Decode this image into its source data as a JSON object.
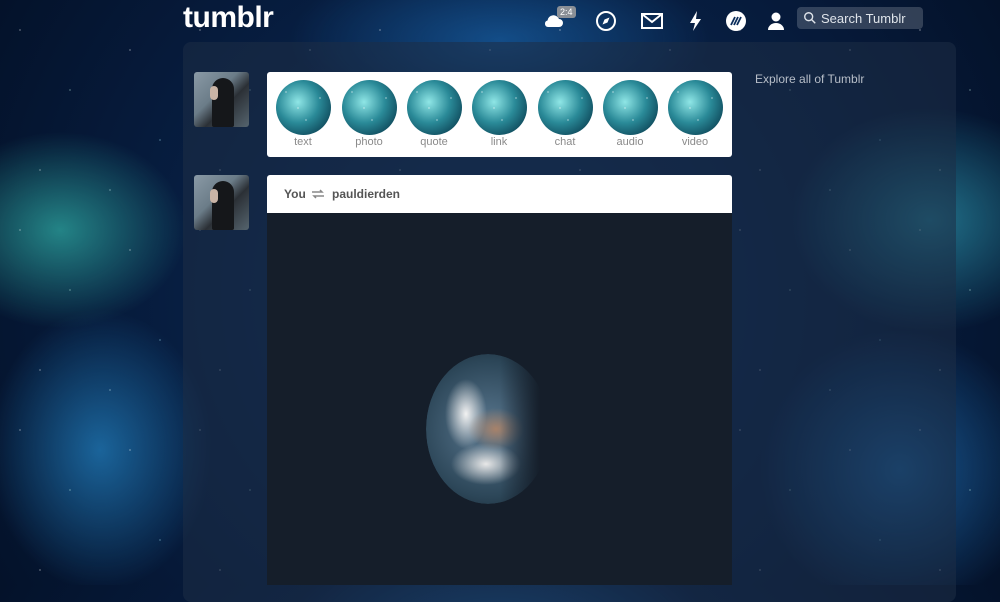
{
  "header": {
    "logo": "tumblr",
    "badge": "2:4",
    "search_placeholder": "Search Tumblr"
  },
  "nav_icons": [
    "dashboard-cloud-icon",
    "explore-compass-icon",
    "inbox-mail-icon",
    "activity-lightning-icon",
    "patio-icon",
    "account-person-icon"
  ],
  "sidebar": {
    "explore_link": "Explore all of Tumblr"
  },
  "compose": {
    "types": [
      {
        "label": "text"
      },
      {
        "label": "photo"
      },
      {
        "label": "quote"
      },
      {
        "label": "link"
      },
      {
        "label": "chat"
      },
      {
        "label": "audio"
      },
      {
        "label": "video"
      }
    ]
  },
  "post": {
    "author": "You",
    "reblogged_from": "pauldierden"
  },
  "colors": {
    "text_gray": "#8a8a8a",
    "header_text": "#555555",
    "panel": "#1e2d46"
  }
}
